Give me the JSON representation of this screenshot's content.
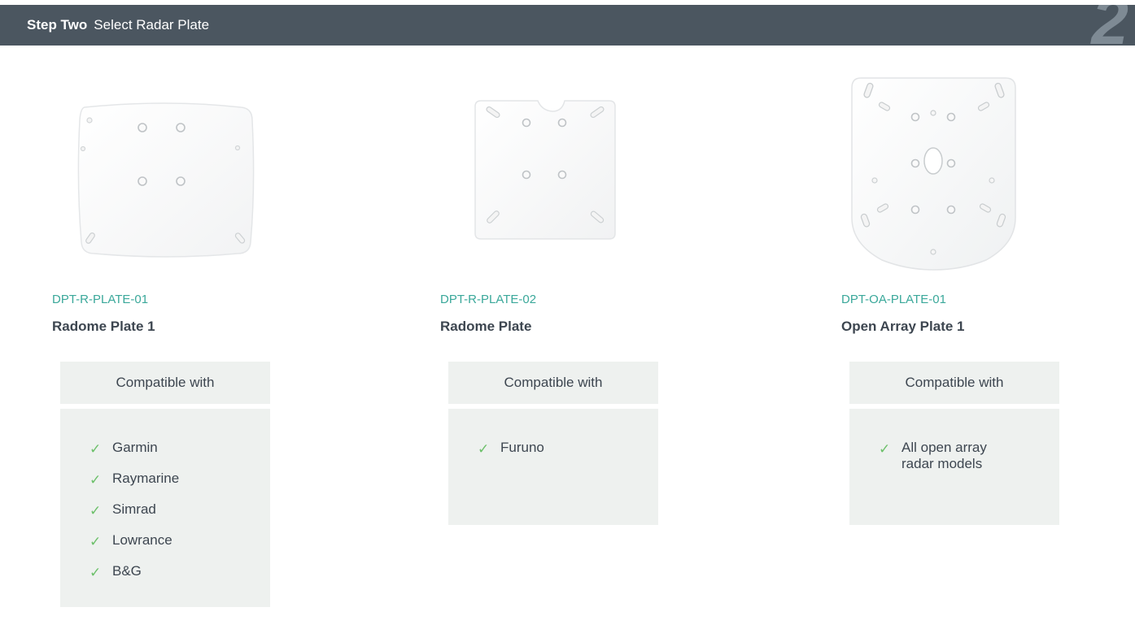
{
  "header": {
    "step_label": "Step Two",
    "title": "Select Radar Plate",
    "step_number": "2"
  },
  "colors": {
    "header_bg": "#4b5660",
    "sku_accent": "#3aa89a",
    "check_accent": "#6cc06a",
    "panel_bg": "#eef1ef"
  },
  "products": [
    {
      "sku": "DPT-R-PLATE-01",
      "name": "Radome Plate 1",
      "compat_heading": "Compatible with",
      "compatible": [
        "Garmin",
        "Raymarine",
        "Simrad",
        "Lowrance",
        "B&G"
      ]
    },
    {
      "sku": "DPT-R-PLATE-02",
      "name": "Radome Plate",
      "compat_heading": "Compatible with",
      "compatible": [
        "Furuno"
      ]
    },
    {
      "sku": "DPT-OA-PLATE-01",
      "name": "Open Array Plate 1",
      "compat_heading": "Compatible with",
      "compatible": [
        "All open array radar models"
      ]
    }
  ],
  "icons": {
    "check": "✓",
    "plate_icon": "radar-plate-icon"
  }
}
